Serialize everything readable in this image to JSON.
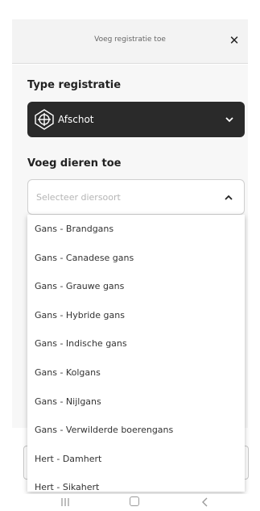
{
  "header": {
    "title": "Voeg registratie toe",
    "close_icon": "close-icon"
  },
  "type_section": {
    "label": "Type registratie",
    "selected_value": "Afschot",
    "icon": "target-icon"
  },
  "animals_section": {
    "label": "Voeg dieren toe",
    "placeholder": "Selecteer diersoort",
    "expanded": true
  },
  "dropdown": {
    "options": [
      "Gans - Brandgans",
      "Gans - Canadese gans",
      "Gans - Grauwe gans",
      "Gans - Hybride gans",
      "Gans - Indische gans",
      "Gans - Kolgans",
      "Gans - Nijlgans",
      "Gans - Verwilderde boerengans",
      "Hert - Damhert",
      "Hert - Sikahert"
    ]
  },
  "nav": {
    "recent": "recent-apps-icon",
    "home": "home-icon",
    "back": "back-icon"
  },
  "colors": {
    "dark_select": "#2a2a2a",
    "header_bg": "#f3f3f3"
  }
}
